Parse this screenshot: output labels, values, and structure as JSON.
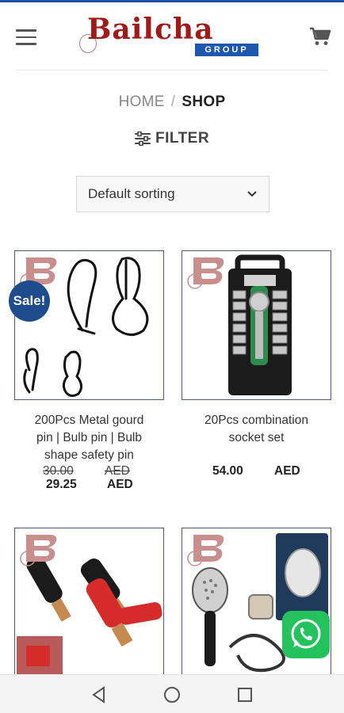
{
  "header": {
    "logo_text": "Bailcha",
    "logo_sub": "GROUP"
  },
  "breadcrumb": {
    "home": "HOME",
    "separator": "/",
    "current": "SHOP"
  },
  "filter": {
    "label": "FILTER"
  },
  "sort": {
    "selected": "Default sorting"
  },
  "products": [
    {
      "title_lines": [
        "200Pcs Metal gourd",
        "pin | Bulb pin | Bulb",
        "shape safety pin"
      ],
      "badge": "Sale!",
      "price_old": "30.00",
      "price_old_currency": "AED",
      "price": "29.25",
      "currency": "AED"
    },
    {
      "title_lines": [
        "20Pcs combination",
        "socket set"
      ],
      "price": "54.00",
      "currency": "AED"
    },
    {
      "title_lines": []
    },
    {
      "title_lines": []
    }
  ],
  "colors": {
    "brand_red": "#a01a1a",
    "brand_blue": "#1f56b0",
    "sale_badge": "#1e4c8f",
    "whatsapp": "#23c25c"
  },
  "icons": {
    "menu": "hamburger-icon",
    "cart": "cart-icon",
    "filter": "sliders-icon",
    "sort": "chevron-down-icon",
    "chat": "whatsapp-icon",
    "nav": [
      "back-triangle-icon",
      "home-circle-icon",
      "recents-square-icon"
    ]
  }
}
